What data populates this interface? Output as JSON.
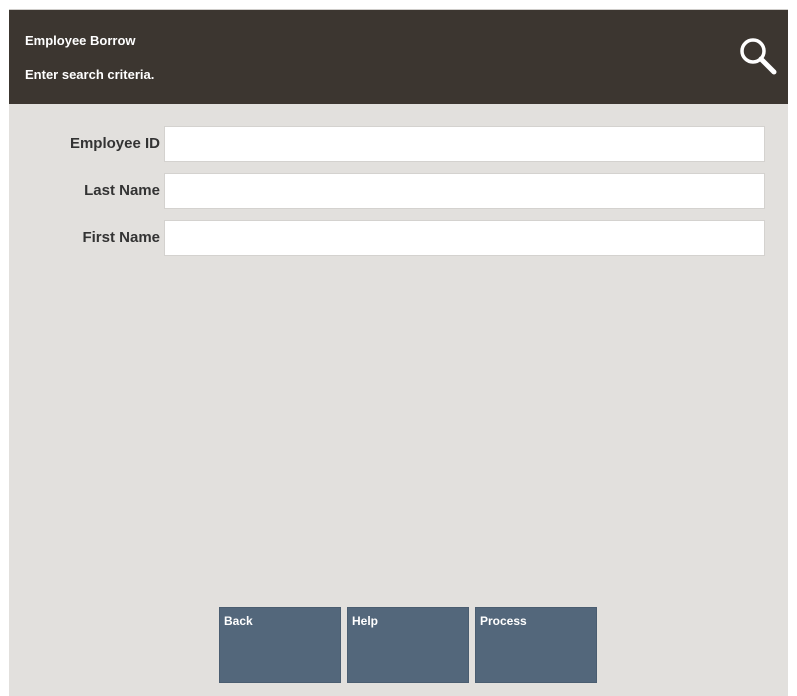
{
  "header": {
    "title": "Employee Borrow",
    "instruction": "Enter search criteria.",
    "icon": "search-icon",
    "background_color": "#3c3630"
  },
  "form": {
    "fields": [
      {
        "label": "Employee ID",
        "value": ""
      },
      {
        "label": "Last Name",
        "value": ""
      },
      {
        "label": "First Name",
        "value": ""
      }
    ]
  },
  "buttons": {
    "back": "Back",
    "help": "Help",
    "process": "Process",
    "color": "#53677b"
  }
}
